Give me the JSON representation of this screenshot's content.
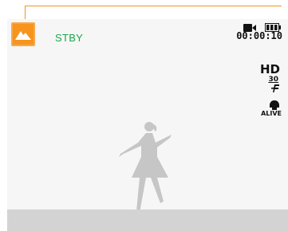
{
  "status": {
    "label": "STBY"
  },
  "timer": {
    "value": "00:00:10"
  },
  "indicators": {
    "resolution": "HD",
    "frame_rate": "30",
    "voice_mode": "ALIVE"
  },
  "icons": {
    "mode": "landscape-mode-icon",
    "recording": "movie-icon",
    "battery": "battery-icon",
    "frame_rate": "frame-rate-icon",
    "voice": "voice-alive-icon"
  },
  "colors": {
    "accent": "#f7941d",
    "status_text": "#1aa64b",
    "screen_bg": "#f6f6f6",
    "bottom_bar": "#d3d3d3"
  }
}
